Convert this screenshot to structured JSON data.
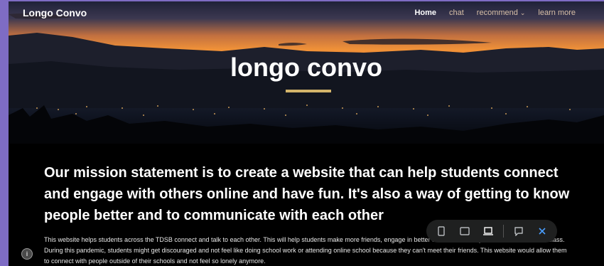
{
  "nav": {
    "brand": "Longo Convo",
    "items": [
      {
        "label": "Home",
        "active": true
      },
      {
        "label": "chat"
      },
      {
        "label": "recommend"
      },
      {
        "label": "learn more"
      }
    ],
    "search_icon": "search-icon"
  },
  "hero": {
    "title": "longo convo"
  },
  "mission": "Our mission statement is to create a website that can help students connect and engage with others online and have fun. It's also a way of getting to know people better and to communicate with each other",
  "body": "This website helps students across the TDSB connect and talk to each other. This will help students make more friends, engage in better activities and inspire them to do better in class. During this pandemic, students might get discouraged and not feel like doing school work or attending online school because they can't meet their friends. This website would allow them to connect with people outside of their schools and not feel so lonely anymore.",
  "preview_toolbar": {
    "icons": [
      "phone-icon",
      "tablet-icon",
      "laptop-icon",
      "feedback-icon",
      "close-icon"
    ],
    "accent": "#4a9eff"
  },
  "colors": {
    "underline": "#d3b46a",
    "page_bg": "#7e6cc4"
  }
}
